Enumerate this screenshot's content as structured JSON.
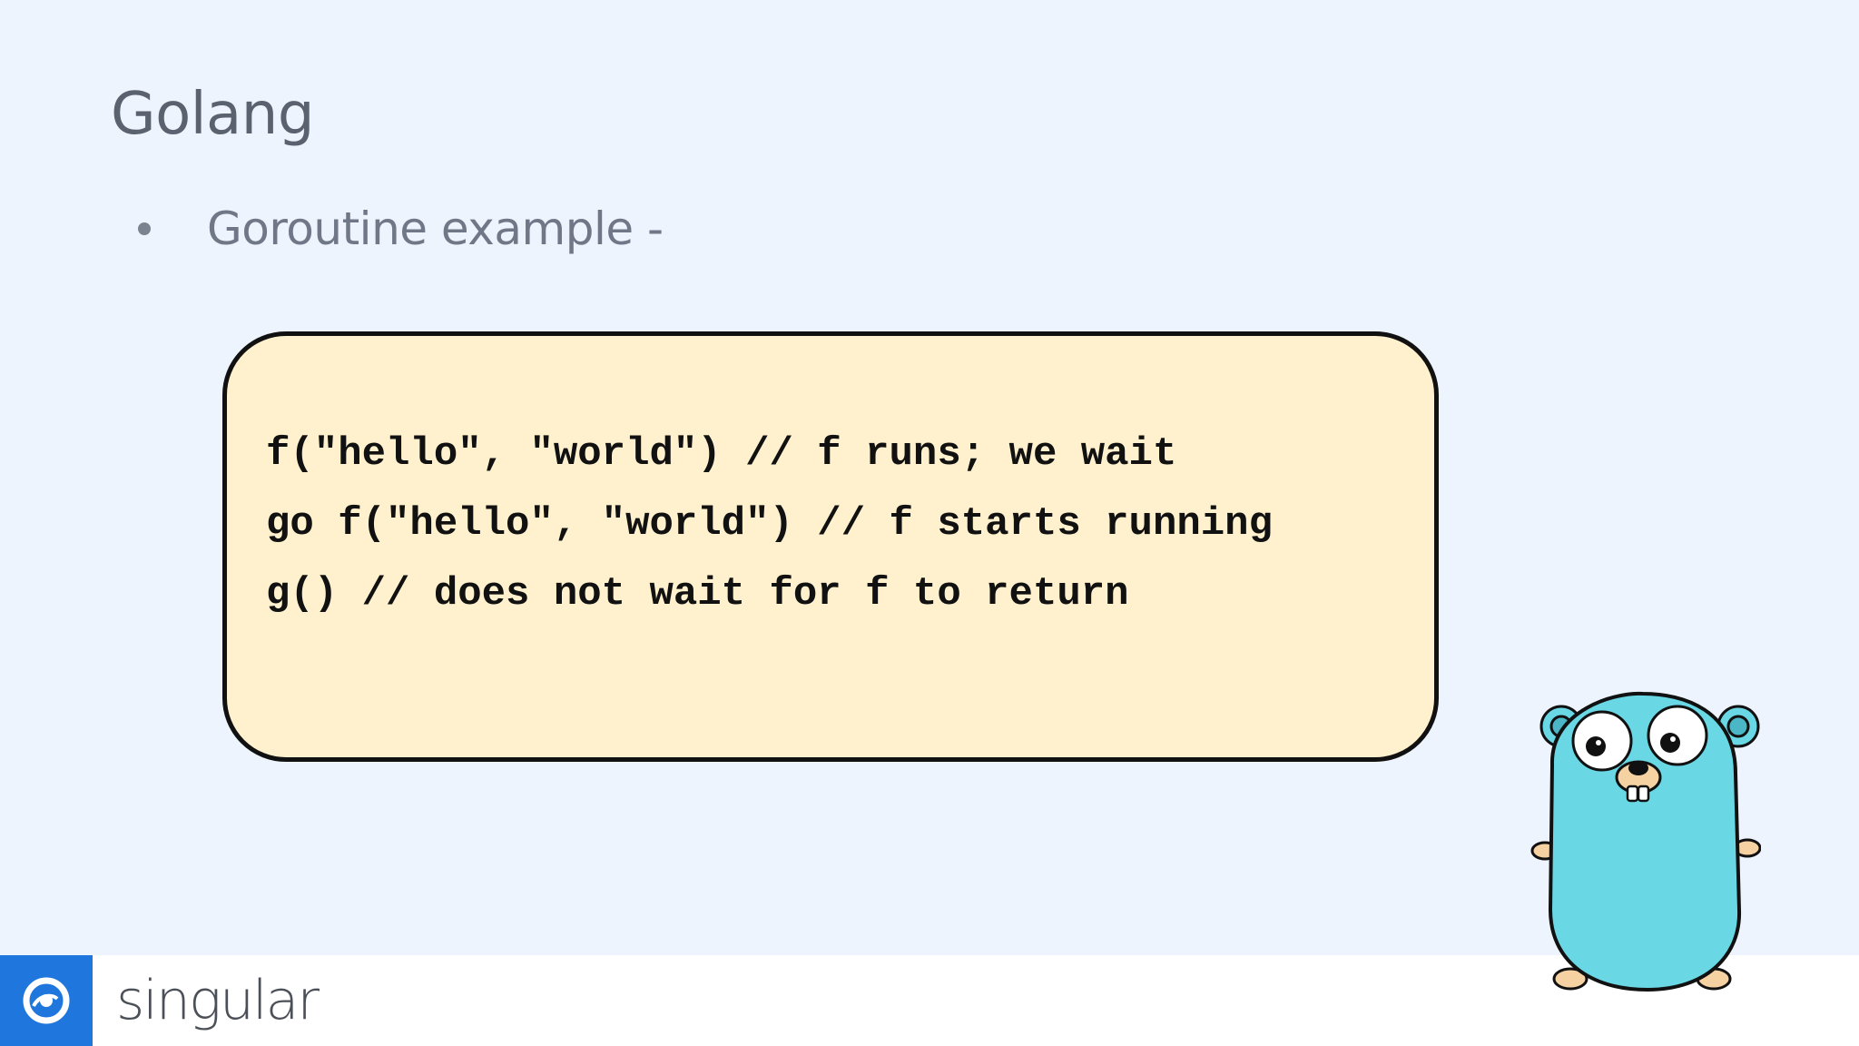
{
  "slide": {
    "title": "Golang",
    "bullet": "Goroutine example -"
  },
  "code": {
    "lines": [
      "f(\"hello\", \"world\") // f runs; we wait",
      "go f(\"hello\", \"world\") // f starts running",
      "g() // does not wait for f to return"
    ]
  },
  "footer": {
    "brand": "singular",
    "brand_color": "#1f76dc"
  },
  "mascot": {
    "icon": "go-gopher-icon"
  },
  "colors": {
    "background": "#eef4fe",
    "code_card": "#fff1cd",
    "gopher_body": "#6ad7e5"
  }
}
